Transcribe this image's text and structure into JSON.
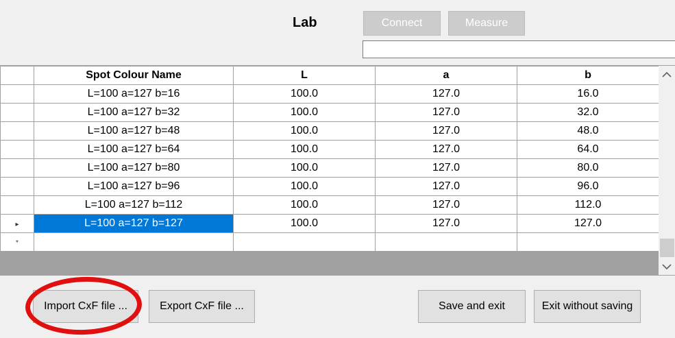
{
  "header": {
    "title": "Lab",
    "connect_label": "Connect",
    "measure_label": "Measure",
    "status_value": ""
  },
  "grid": {
    "columns": [
      "Spot Colour Name",
      "L",
      "a",
      "b"
    ],
    "rows": [
      {
        "name": "L=100 a=127 b=16",
        "L": "100.0",
        "a": "127.0",
        "b": "16.0"
      },
      {
        "name": "L=100 a=127 b=32",
        "L": "100.0",
        "a": "127.0",
        "b": "32.0"
      },
      {
        "name": "L=100 a=127 b=48",
        "L": "100.0",
        "a": "127.0",
        "b": "48.0"
      },
      {
        "name": "L=100 a=127 b=64",
        "L": "100.0",
        "a": "127.0",
        "b": "64.0"
      },
      {
        "name": "L=100 a=127 b=80",
        "L": "100.0",
        "a": "127.0",
        "b": "80.0"
      },
      {
        "name": "L=100 a=127 b=96",
        "L": "100.0",
        "a": "127.0",
        "b": "96.0"
      },
      {
        "name": "L=100 a=127 b=112",
        "L": "100.0",
        "a": "127.0",
        "b": "112.0"
      },
      {
        "name": "L=100 a=127 b=127",
        "L": "100.0",
        "a": "127.0",
        "b": "127.0"
      }
    ],
    "selected_row": 7,
    "current_row_marker": "▸",
    "new_row_marker": "*"
  },
  "scrollbar": {
    "up_icon": "chevron-up-icon",
    "down_icon": "chevron-down-icon"
  },
  "footer": {
    "import_label": "Import CxF file ...",
    "export_label": "Export CxF file ...",
    "save_label": "Save and exit",
    "exit_label": "Exit without saving"
  },
  "colors": {
    "selection": "#0078d7",
    "highlight_annotation": "#e01010"
  }
}
